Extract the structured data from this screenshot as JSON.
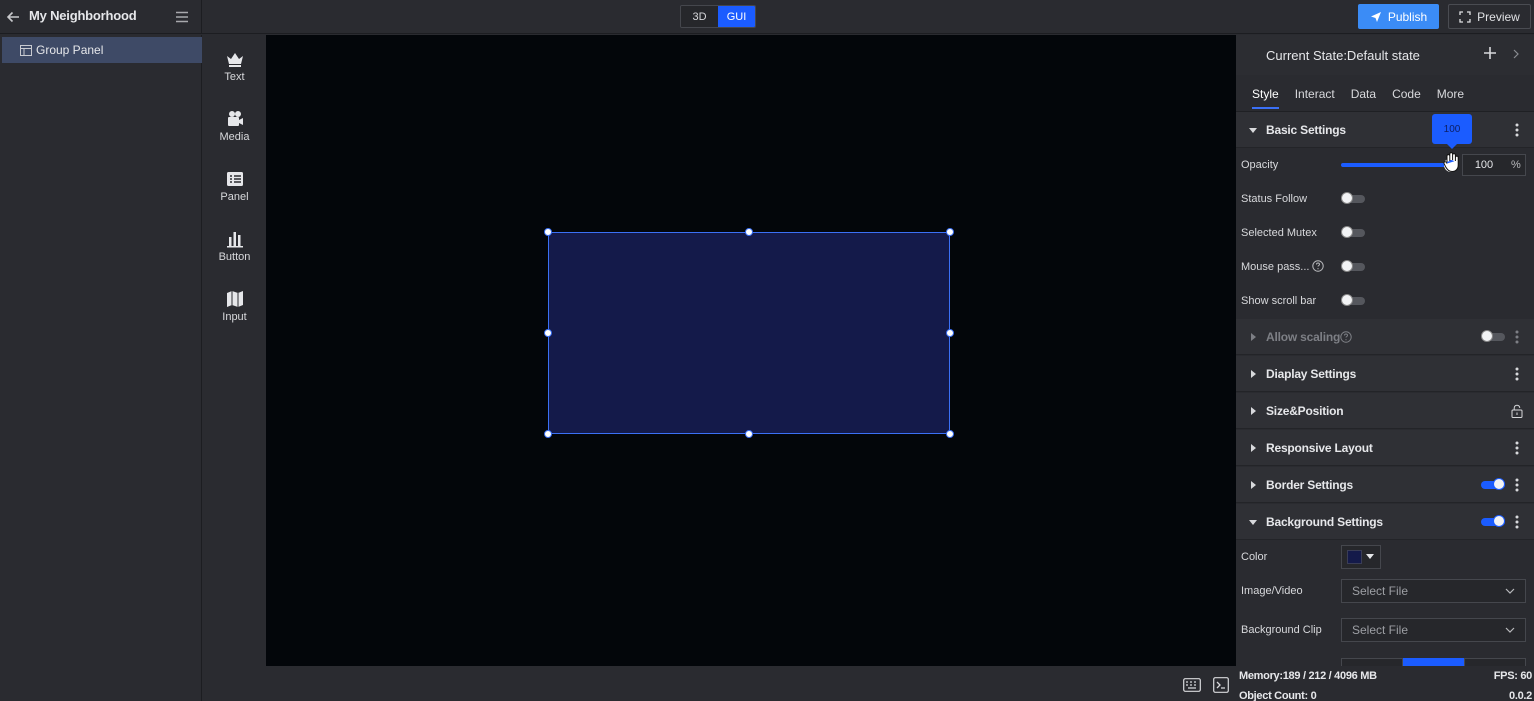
{
  "app": {
    "project_title": "My Neighborhood"
  },
  "topbar": {
    "mode_3d": "3D",
    "mode_gui": "GUI",
    "active_mode": "GUI",
    "publish_label": "Publish",
    "preview_label": "Preview",
    "accent_color": "#1b5cff"
  },
  "layers": {
    "items": [
      {
        "label": "Group Panel",
        "selected": true,
        "icon": "panel-icon"
      }
    ]
  },
  "components": {
    "items": [
      {
        "label": "Text",
        "icon": "crown-icon"
      },
      {
        "label": "Media",
        "icon": "media-icon"
      },
      {
        "label": "Panel",
        "icon": "panel-list-icon"
      },
      {
        "label": "Button",
        "icon": "bar-chart-icon"
      },
      {
        "label": "Input",
        "icon": "map-icon"
      }
    ]
  },
  "canvas": {
    "background": "#03060a",
    "selected_fill": "#141a4a",
    "selection_color": "#3b70f5"
  },
  "right_panel": {
    "state_label": "Current State:Default state",
    "tabs": [
      {
        "label": "Style",
        "active": true
      },
      {
        "label": "Interact",
        "active": false
      },
      {
        "label": "Data",
        "active": false
      },
      {
        "label": "Code",
        "active": false
      },
      {
        "label": "More",
        "active": false
      }
    ],
    "basic_settings": {
      "title": "Basic Settings",
      "opacity_label": "Opacity",
      "opacity_value": "100",
      "opacity_tooltip": "100",
      "opacity_unit": "%",
      "opacity_fraction": 1.0,
      "status_follow_label": "Status Follow",
      "status_follow_on": false,
      "selected_mutex_label": "Selected Mutex",
      "selected_mutex_on": false,
      "mouse_pass_label": "Mouse pass...",
      "mouse_pass_on": false,
      "show_scroll_label": "Show scroll bar",
      "show_scroll_on": false
    },
    "allow_scaling": {
      "title": "Allow scaling",
      "on": false
    },
    "display_settings": {
      "title": "Diaplay Settings"
    },
    "size_position": {
      "title": "Size&Position"
    },
    "responsive_layout": {
      "title": "Responsive Layout"
    },
    "border_settings": {
      "title": "Border Settings",
      "on": true
    },
    "background_settings": {
      "title": "Background Settings",
      "on": true,
      "color_label": "Color",
      "color_value": "#141a4a",
      "image_video_label": "Image/Video",
      "image_video_placeholder": "Select File",
      "background_clip_label": "Background Clip",
      "background_clip_placeholder": "Select File"
    },
    "footer": {
      "memory": "Memory:189 / 212 / 4096 MB",
      "object_count": "Object Count: 0",
      "fps": "FPS: 60",
      "version": "0.0.2"
    }
  }
}
